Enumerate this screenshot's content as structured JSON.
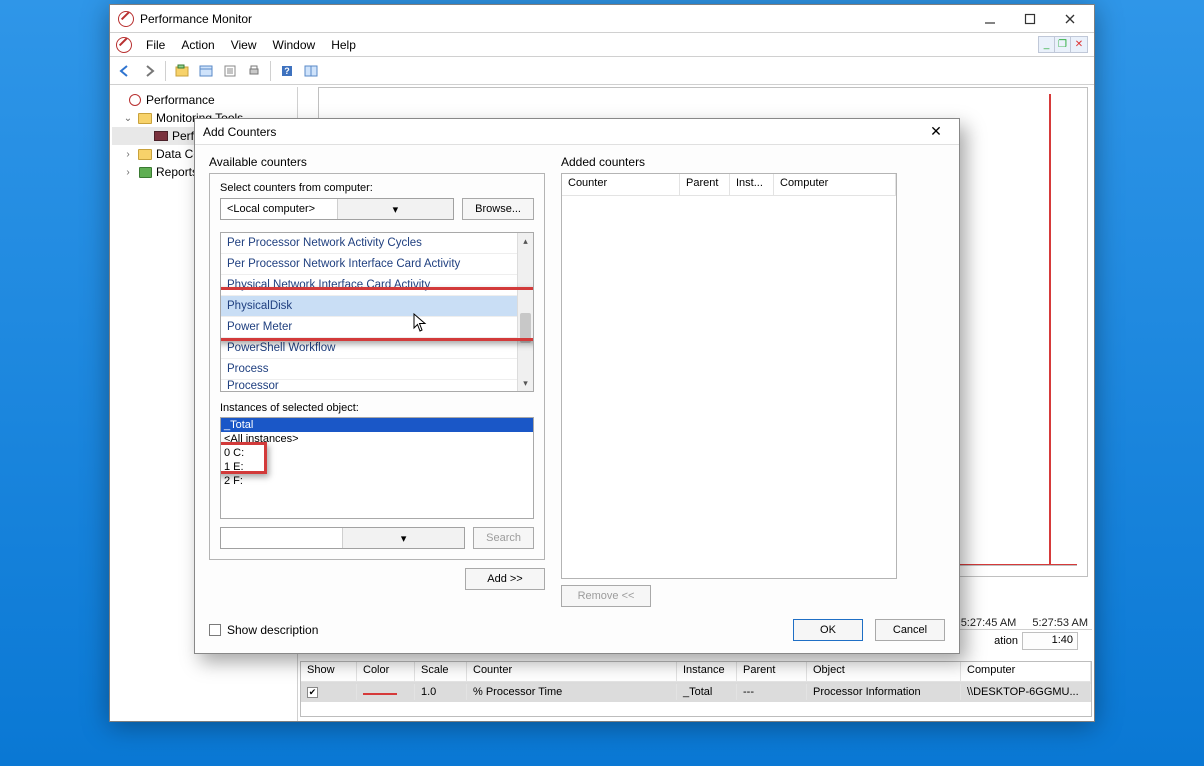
{
  "perfmon": {
    "window_title": "Performance Monitor",
    "menu": {
      "file": "File",
      "action": "Action",
      "view": "View",
      "window": "Window",
      "help": "Help"
    },
    "tree": {
      "root": "Performance",
      "monitoring_tools": "Monitoring Tools",
      "performance_monitor": "Performance Monitor",
      "data_collector_sets": "Data Collector Sets",
      "reports": "Reports"
    },
    "chart": {
      "time1": "5:27:45 AM",
      "time2": "5:27:53 AM"
    },
    "legend": {
      "duration_label": "ation",
      "duration_value": "1:40"
    },
    "grid": {
      "headers": {
        "show": "Show",
        "color": "Color",
        "scale": "Scale",
        "counter": "Counter",
        "instance": "Instance",
        "parent": "Parent",
        "object": "Object",
        "computer": "Computer"
      },
      "row": {
        "scale": "1.0",
        "counter": "% Processor Time",
        "instance": "_Total",
        "parent": "---",
        "object": "Processor Information",
        "computer": "\\\\DESKTOP-6GGMU..."
      }
    }
  },
  "dialog": {
    "title": "Add Counters",
    "available_counters_label": "Available counters",
    "select_computer_label": "Select counters from computer:",
    "computer_value": "<Local computer>",
    "browse_btn": "Browse...",
    "counter_items": [
      "Per Processor Network Activity Cycles",
      "Per Processor Network Interface Card Activity",
      "Physical Network Interface Card Activity",
      "PhysicalDisk",
      "Power Meter",
      "PowerShell Workflow",
      "Process",
      "Processor"
    ],
    "instances_label": "Instances of selected object:",
    "instances": [
      "_Total",
      "<All instances>",
      "0 C:",
      "1 E:",
      "2 F:"
    ],
    "search_btn": "Search",
    "add_btn": "Add >>",
    "added_counters_label": "Added counters",
    "added_headers": {
      "counter": "Counter",
      "parent": "Parent",
      "inst": "Inst...",
      "computer": "Computer"
    },
    "remove_btn": "Remove <<",
    "show_description": "Show description",
    "ok": "OK",
    "cancel": "Cancel"
  }
}
